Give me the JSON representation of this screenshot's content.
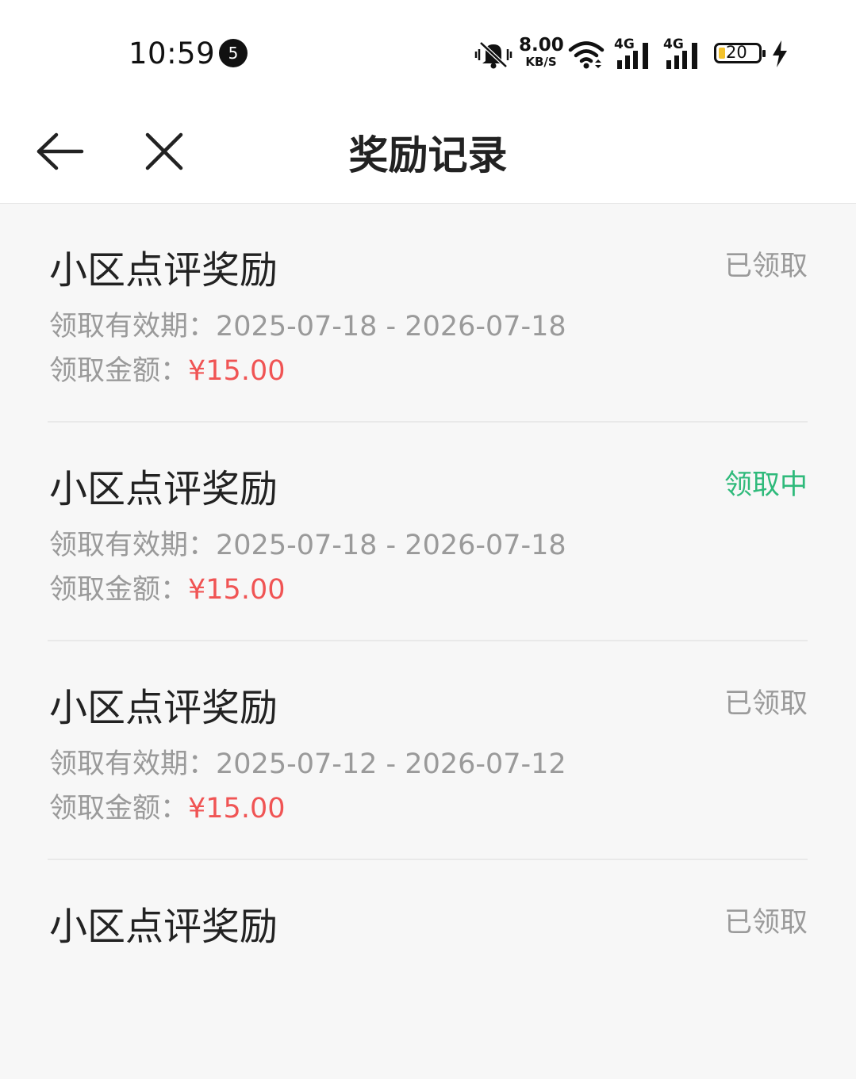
{
  "status_bar": {
    "time": "10:59",
    "notification_count": "5",
    "net_speed_value": "8.00",
    "net_speed_unit": "KB/S",
    "network_1": "4G",
    "network_2": "4G",
    "battery_level": "20",
    "icons": [
      "mute-icon",
      "wifi-icon",
      "signal-icon",
      "battery-icon",
      "charging-icon"
    ]
  },
  "nav": {
    "title": "奖励记录",
    "icons": [
      "back-arrow-icon",
      "close-icon"
    ]
  },
  "records": [
    {
      "title": "小区点评奖励",
      "status": "已领取",
      "validity_label": "领取有效期：",
      "validity_value": "2025-07-18 - 2026-07-18",
      "amount_label": "领取金额：",
      "amount_value": "¥15.00"
    },
    {
      "title": "小区点评奖励",
      "status": "领取中",
      "validity_label": "领取有效期：",
      "validity_value": "2025-07-18 - 2026-07-18",
      "amount_label": "领取金额：",
      "amount_value": "¥15.00"
    },
    {
      "title": "小区点评奖励",
      "status": "已领取",
      "validity_label": "领取有效期：",
      "validity_value": "2025-07-12 - 2026-07-12",
      "amount_label": "领取金额：",
      "amount_value": "¥15.00"
    },
    {
      "title": "小区点评奖励",
      "status": "已领取"
    }
  ],
  "colors": {
    "amount": "#f05454",
    "status_done": "#9a9a9a",
    "status_pending": "#2fba7b",
    "background": "#f7f7f7"
  }
}
